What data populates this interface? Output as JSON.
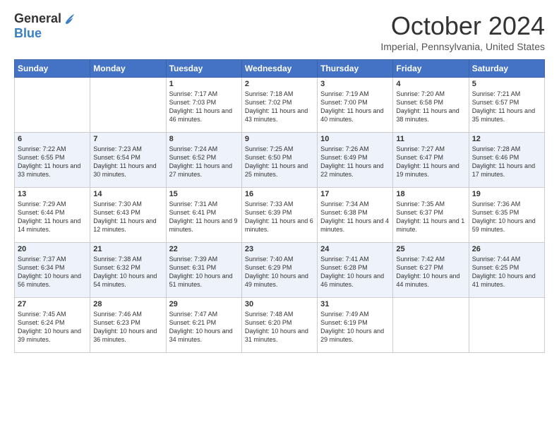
{
  "header": {
    "logo_general": "General",
    "logo_blue": "Blue",
    "month": "October 2024",
    "location": "Imperial, Pennsylvania, United States"
  },
  "days_of_week": [
    "Sunday",
    "Monday",
    "Tuesday",
    "Wednesday",
    "Thursday",
    "Friday",
    "Saturday"
  ],
  "weeks": [
    [
      {
        "day": "",
        "info": ""
      },
      {
        "day": "",
        "info": ""
      },
      {
        "day": "1",
        "info": "Sunrise: 7:17 AM\nSunset: 7:03 PM\nDaylight: 11 hours and 46 minutes."
      },
      {
        "day": "2",
        "info": "Sunrise: 7:18 AM\nSunset: 7:02 PM\nDaylight: 11 hours and 43 minutes."
      },
      {
        "day": "3",
        "info": "Sunrise: 7:19 AM\nSunset: 7:00 PM\nDaylight: 11 hours and 40 minutes."
      },
      {
        "day": "4",
        "info": "Sunrise: 7:20 AM\nSunset: 6:58 PM\nDaylight: 11 hours and 38 minutes."
      },
      {
        "day": "5",
        "info": "Sunrise: 7:21 AM\nSunset: 6:57 PM\nDaylight: 11 hours and 35 minutes."
      }
    ],
    [
      {
        "day": "6",
        "info": "Sunrise: 7:22 AM\nSunset: 6:55 PM\nDaylight: 11 hours and 33 minutes."
      },
      {
        "day": "7",
        "info": "Sunrise: 7:23 AM\nSunset: 6:54 PM\nDaylight: 11 hours and 30 minutes."
      },
      {
        "day": "8",
        "info": "Sunrise: 7:24 AM\nSunset: 6:52 PM\nDaylight: 11 hours and 27 minutes."
      },
      {
        "day": "9",
        "info": "Sunrise: 7:25 AM\nSunset: 6:50 PM\nDaylight: 11 hours and 25 minutes."
      },
      {
        "day": "10",
        "info": "Sunrise: 7:26 AM\nSunset: 6:49 PM\nDaylight: 11 hours and 22 minutes."
      },
      {
        "day": "11",
        "info": "Sunrise: 7:27 AM\nSunset: 6:47 PM\nDaylight: 11 hours and 19 minutes."
      },
      {
        "day": "12",
        "info": "Sunrise: 7:28 AM\nSunset: 6:46 PM\nDaylight: 11 hours and 17 minutes."
      }
    ],
    [
      {
        "day": "13",
        "info": "Sunrise: 7:29 AM\nSunset: 6:44 PM\nDaylight: 11 hours and 14 minutes."
      },
      {
        "day": "14",
        "info": "Sunrise: 7:30 AM\nSunset: 6:43 PM\nDaylight: 11 hours and 12 minutes."
      },
      {
        "day": "15",
        "info": "Sunrise: 7:31 AM\nSunset: 6:41 PM\nDaylight: 11 hours and 9 minutes."
      },
      {
        "day": "16",
        "info": "Sunrise: 7:33 AM\nSunset: 6:39 PM\nDaylight: 11 hours and 6 minutes."
      },
      {
        "day": "17",
        "info": "Sunrise: 7:34 AM\nSunset: 6:38 PM\nDaylight: 11 hours and 4 minutes."
      },
      {
        "day": "18",
        "info": "Sunrise: 7:35 AM\nSunset: 6:37 PM\nDaylight: 11 hours and 1 minute."
      },
      {
        "day": "19",
        "info": "Sunrise: 7:36 AM\nSunset: 6:35 PM\nDaylight: 10 hours and 59 minutes."
      }
    ],
    [
      {
        "day": "20",
        "info": "Sunrise: 7:37 AM\nSunset: 6:34 PM\nDaylight: 10 hours and 56 minutes."
      },
      {
        "day": "21",
        "info": "Sunrise: 7:38 AM\nSunset: 6:32 PM\nDaylight: 10 hours and 54 minutes."
      },
      {
        "day": "22",
        "info": "Sunrise: 7:39 AM\nSunset: 6:31 PM\nDaylight: 10 hours and 51 minutes."
      },
      {
        "day": "23",
        "info": "Sunrise: 7:40 AM\nSunset: 6:29 PM\nDaylight: 10 hours and 49 minutes."
      },
      {
        "day": "24",
        "info": "Sunrise: 7:41 AM\nSunset: 6:28 PM\nDaylight: 10 hours and 46 minutes."
      },
      {
        "day": "25",
        "info": "Sunrise: 7:42 AM\nSunset: 6:27 PM\nDaylight: 10 hours and 44 minutes."
      },
      {
        "day": "26",
        "info": "Sunrise: 7:44 AM\nSunset: 6:25 PM\nDaylight: 10 hours and 41 minutes."
      }
    ],
    [
      {
        "day": "27",
        "info": "Sunrise: 7:45 AM\nSunset: 6:24 PM\nDaylight: 10 hours and 39 minutes."
      },
      {
        "day": "28",
        "info": "Sunrise: 7:46 AM\nSunset: 6:23 PM\nDaylight: 10 hours and 36 minutes."
      },
      {
        "day": "29",
        "info": "Sunrise: 7:47 AM\nSunset: 6:21 PM\nDaylight: 10 hours and 34 minutes."
      },
      {
        "day": "30",
        "info": "Sunrise: 7:48 AM\nSunset: 6:20 PM\nDaylight: 10 hours and 31 minutes."
      },
      {
        "day": "31",
        "info": "Sunrise: 7:49 AM\nSunset: 6:19 PM\nDaylight: 10 hours and 29 minutes."
      },
      {
        "day": "",
        "info": ""
      },
      {
        "day": "",
        "info": ""
      }
    ]
  ]
}
